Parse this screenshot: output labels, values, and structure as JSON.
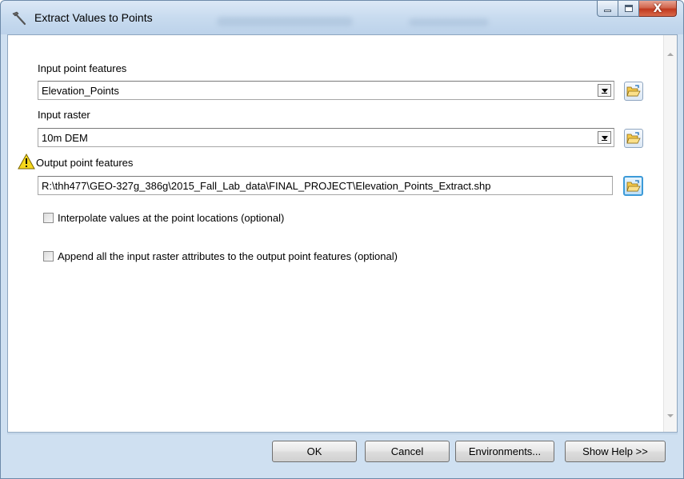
{
  "window": {
    "title": "Extract Values to Points",
    "close_glyph": "X"
  },
  "form": {
    "input_point_features": {
      "label": "Input point features",
      "value": "Elevation_Points"
    },
    "input_raster": {
      "label": "Input raster",
      "value": "10m DEM"
    },
    "output_point_features": {
      "label": "Output point features",
      "value": "R:\\thh477\\GEO-327g_386g\\2015_Fall_Lab_data\\FINAL_PROJECT\\Elevation_Points_Extract.shp",
      "warning_icon": "warning-triangle-icon"
    },
    "options": [
      {
        "label": "Interpolate values at the point locations (optional)",
        "checked": false
      },
      {
        "label": "Append all the input raster attributes to the output point features (optional)",
        "checked": false
      }
    ]
  },
  "buttons": {
    "ok": "OK",
    "cancel": "Cancel",
    "environments": "Environments...",
    "show_help": "Show Help >>"
  },
  "icons": {
    "title": "hammer-icon",
    "browse": "open-folder-icon"
  },
  "colors": {
    "warning_fill": "#f7d81c",
    "folder_fill": "#f5c94a",
    "close_red": "#c0391f"
  }
}
